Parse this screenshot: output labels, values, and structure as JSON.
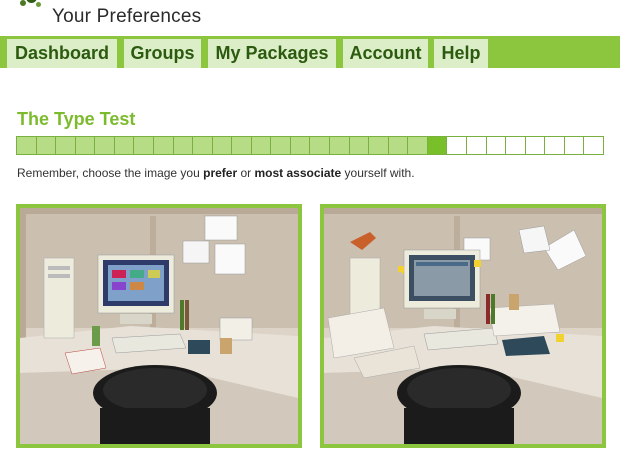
{
  "header": {
    "title": "Your Preferences",
    "logo_icon": "green-dots-logo-icon"
  },
  "nav": {
    "tabs": [
      {
        "label": "Dashboard"
      },
      {
        "label": "Groups"
      },
      {
        "label": "My Packages"
      },
      {
        "label": "Account"
      },
      {
        "label": "Help"
      }
    ]
  },
  "test": {
    "title": "The Type Test",
    "progress": {
      "completed": 21,
      "current": 22,
      "total": 30
    },
    "instruction": {
      "before": "Remember, choose the image you ",
      "bold1": "prefer",
      "middle": " or ",
      "bold2": "most associate",
      "after": " yourself with."
    }
  },
  "choices": [
    {
      "description_icon": "tidy-desk-office-illustration"
    },
    {
      "description_icon": "messy-desk-office-illustration"
    }
  ],
  "colors": {
    "accent": "#8cc63f",
    "tab_bg": "#dbeec7",
    "tab_text": "#2c5a0f",
    "title_green": "#7dbb2e"
  }
}
